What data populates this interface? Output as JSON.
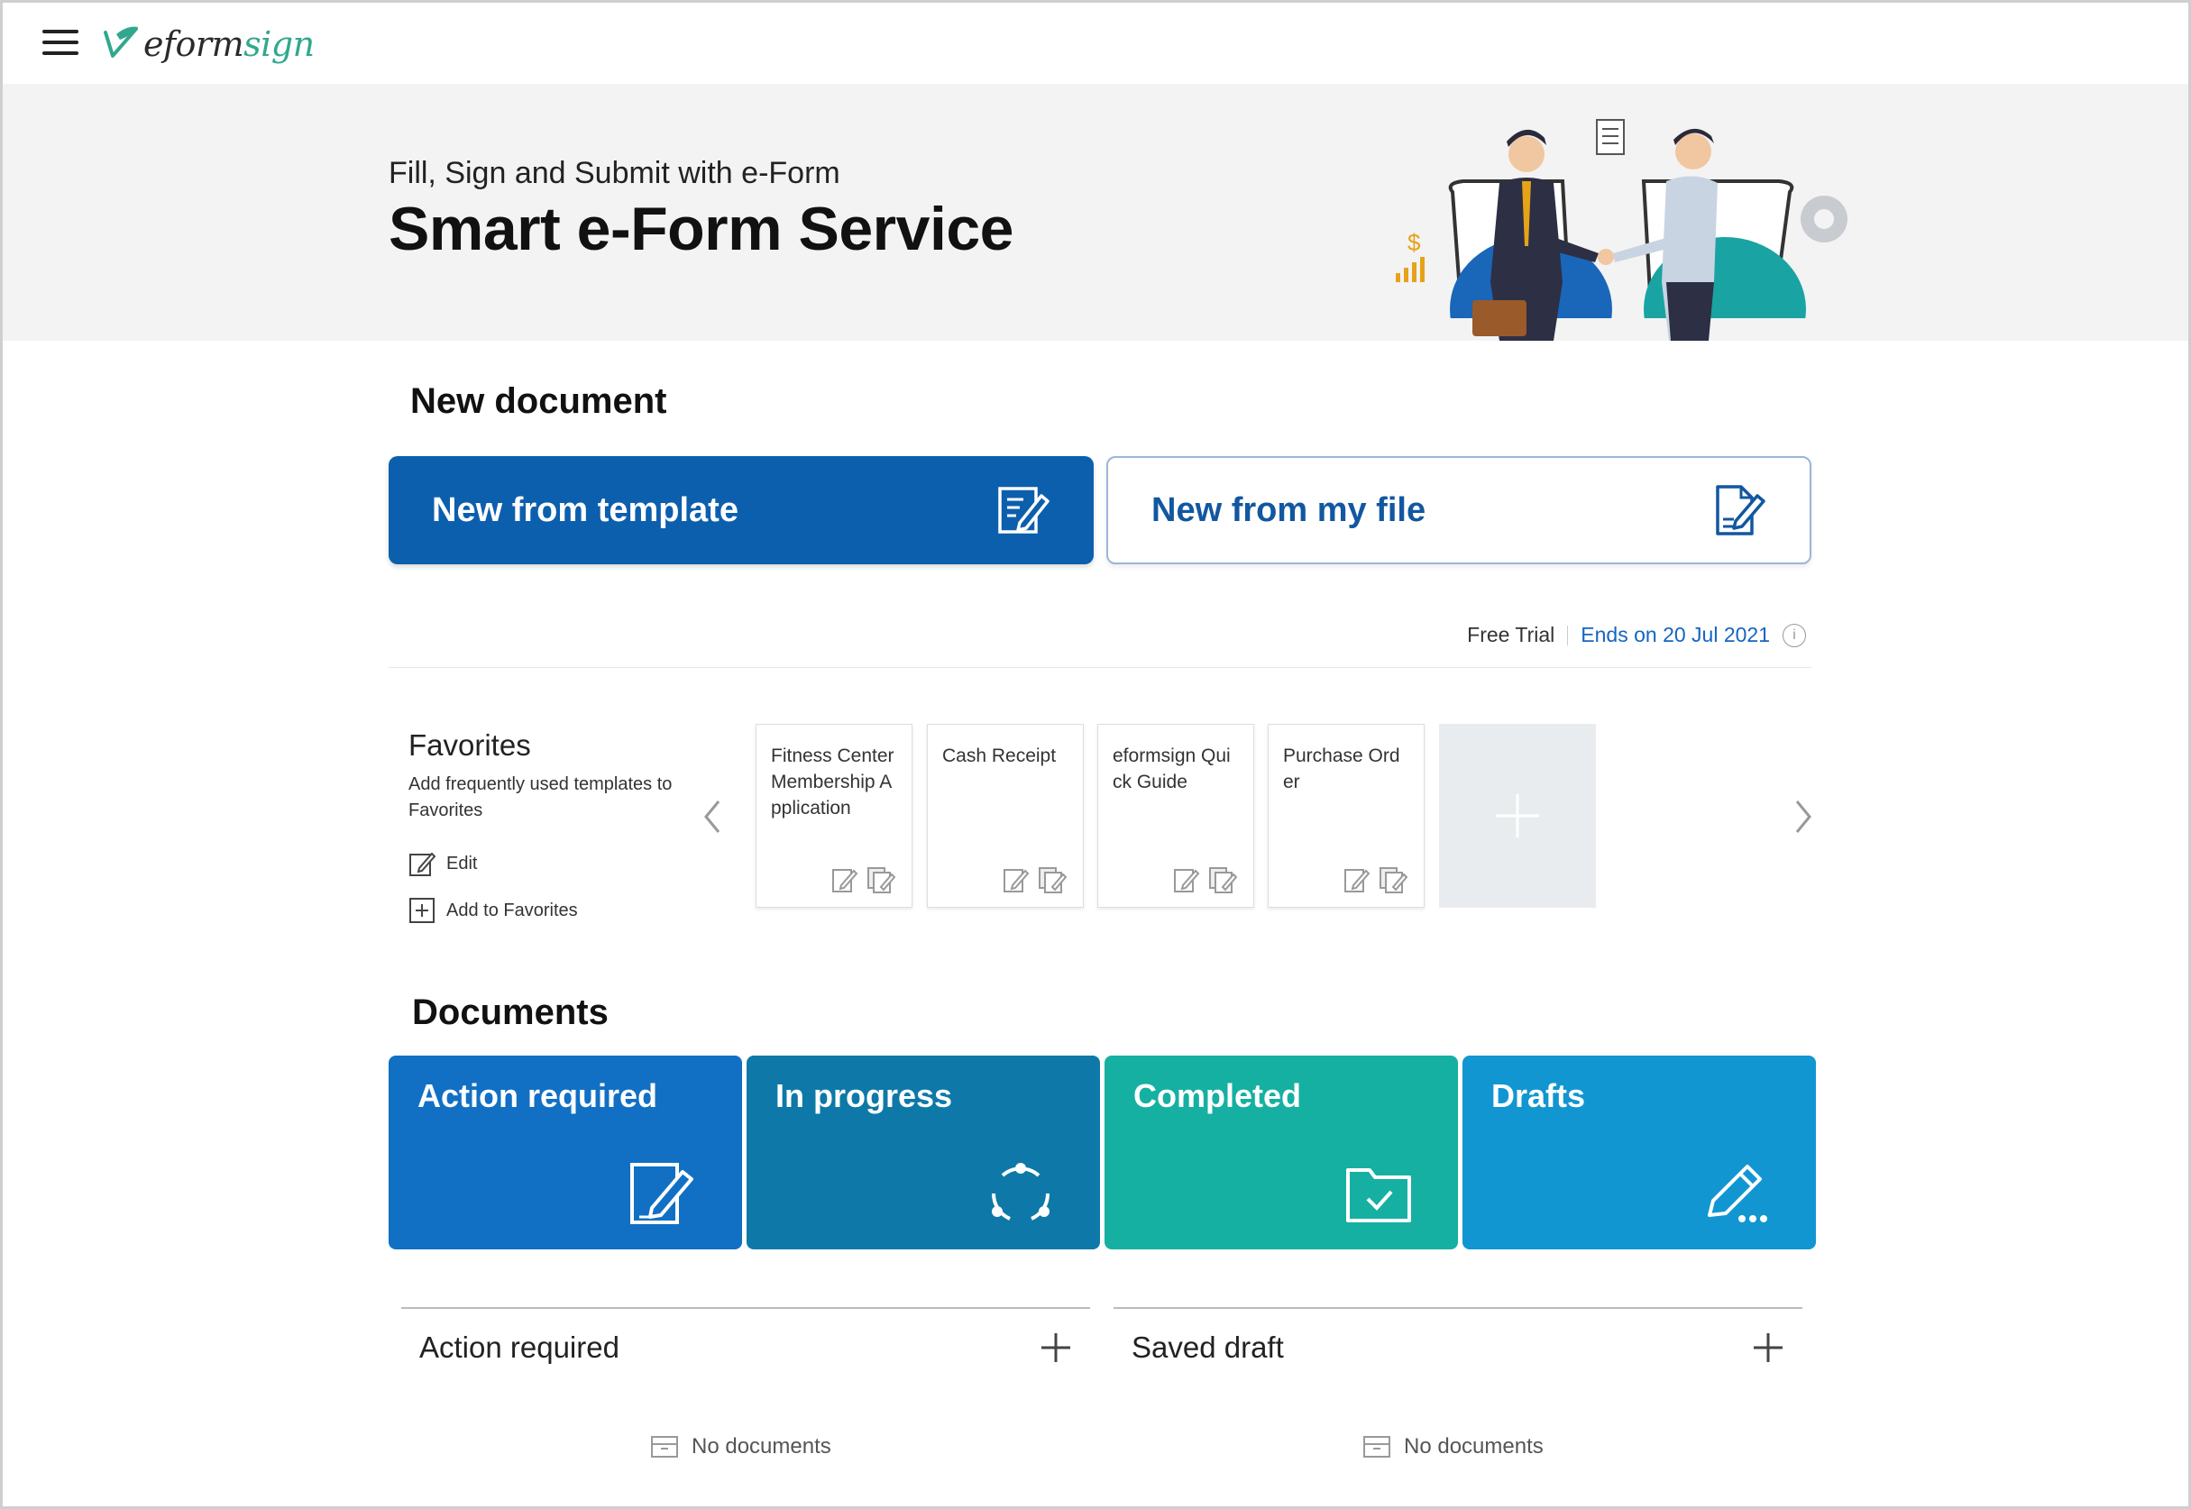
{
  "app": {
    "logo_text_main": "eform",
    "logo_text_accent": "sign"
  },
  "hero": {
    "subtitle": "Fill, Sign and Submit with e-Form",
    "title": "Smart e-Form Service"
  },
  "new_document": {
    "heading": "New document",
    "from_template_label": "New from template",
    "from_file_label": "New from my file"
  },
  "trial": {
    "label": "Free Trial",
    "ends": "Ends on 20 Jul 2021"
  },
  "favorites": {
    "title": "Favorites",
    "description": "Add frequently used templates to Favorites",
    "edit_label": "Edit",
    "add_label": "Add to Favorites",
    "cards": [
      {
        "label": "Fitness Center Membership Application"
      },
      {
        "label": "Cash Receipt"
      },
      {
        "label": "eformsign Quick Guide"
      },
      {
        "label": "Purchase Order"
      }
    ]
  },
  "documents": {
    "heading": "Documents",
    "tiles": [
      {
        "label": "Action required",
        "color": "#1170c4",
        "icon": "edit-document-icon"
      },
      {
        "label": "In progress",
        "color": "#0e79a8",
        "icon": "progress-cycle-icon"
      },
      {
        "label": "Completed",
        "color": "#16b0a2",
        "icon": "folder-check-icon"
      },
      {
        "label": "Drafts",
        "color": "#1296d1",
        "icon": "pencil-draft-icon"
      }
    ]
  },
  "lists": {
    "action_required": {
      "title": "Action required",
      "empty": "No documents"
    },
    "saved_draft": {
      "title": "Saved draft",
      "empty": "No documents"
    }
  }
}
